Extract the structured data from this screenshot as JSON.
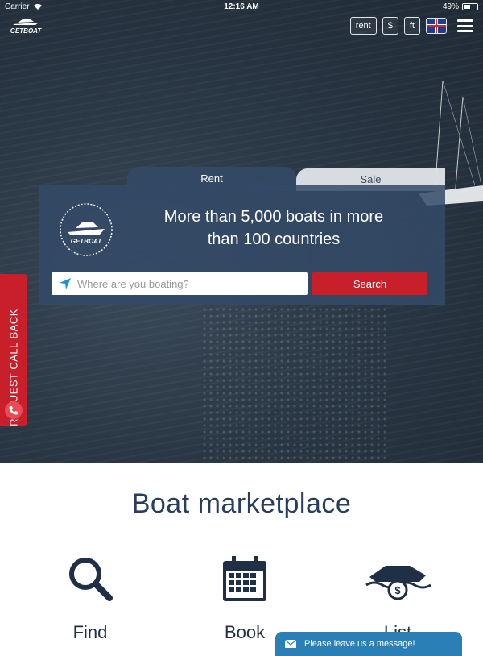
{
  "status_bar": {
    "carrier": "Carrier",
    "time": "12:16 AM",
    "battery": "49%",
    "battery_level": 0.49
  },
  "header": {
    "logo_text": "GETBOAT",
    "rent_label": "rent",
    "currency_label": "$",
    "units_label": "ft"
  },
  "search": {
    "tabs": [
      {
        "label": "Rent"
      },
      {
        "label": "Sale"
      }
    ],
    "headline_line1": "More than 5,000 boats in more",
    "headline_line2": "than 100 countries",
    "placeholder": "Where are you boating?",
    "button_label": "Search",
    "panel_logo_text": "GETBOAT"
  },
  "callback": {
    "label": "REQUEST CALL BACK"
  },
  "marketplace": {
    "title": "Boat marketplace",
    "features": [
      {
        "label": "Find",
        "icon": "magnifier-icon"
      },
      {
        "label": "Book",
        "icon": "calendar-icon"
      },
      {
        "label": "List",
        "icon": "boat-money-icon"
      }
    ]
  },
  "chat": {
    "label": "Please leave us a message!"
  },
  "colors": {
    "accent_red": "#c81f2a",
    "navy": "#2a3e5c",
    "chat_blue": "#2a7fb7"
  }
}
